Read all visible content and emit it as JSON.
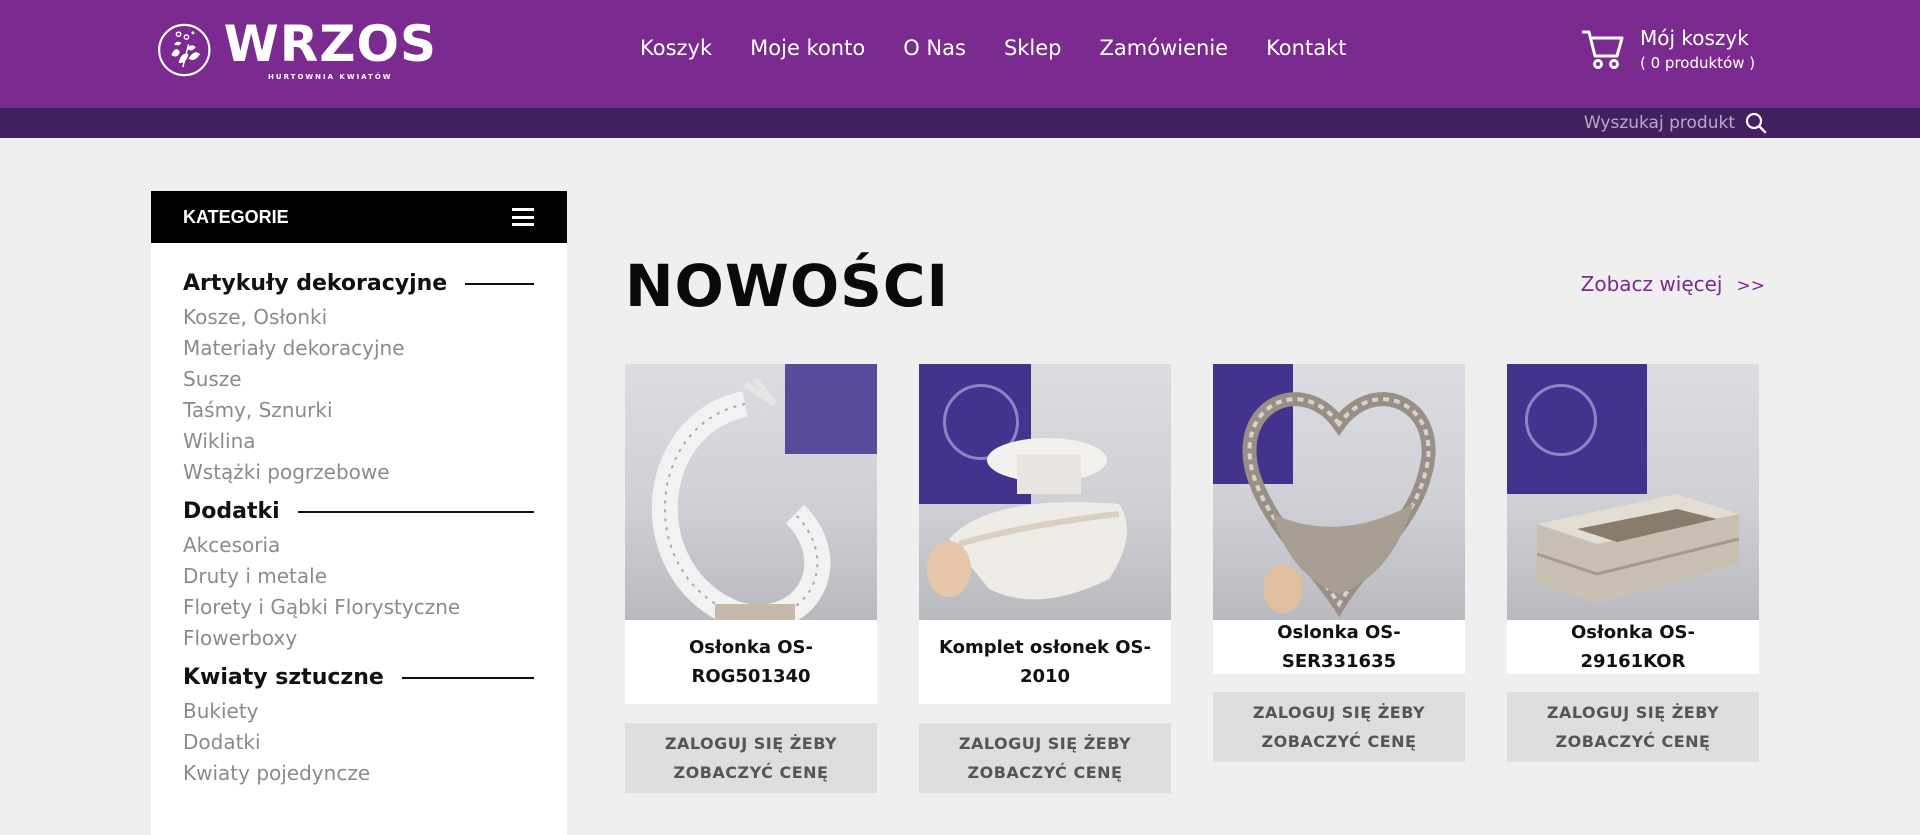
{
  "header": {
    "logo": {
      "word": "WRZOS",
      "subtitle": "HURTOWNIA KWIATÓW"
    },
    "nav": [
      "Koszyk",
      "Moje konto",
      "O Nas",
      "Sklep",
      "Zamówienie",
      "Kontakt"
    ],
    "cart": {
      "title": "Mój koszyk",
      "count": "( 0 produktów )"
    },
    "search": {
      "placeholder": "Wyszukaj produkt"
    },
    "colors": {
      "primary": "#7b2a90",
      "dark": "#42205f"
    }
  },
  "sidebar": {
    "title": "KATEGORIE",
    "groups": [
      {
        "title": "Artykuły dekoracyjne",
        "items": [
          "Kosze, Osłonki",
          "Materiały dekoracyjne",
          "Susze",
          "Taśmy, Sznurki",
          "Wiklina",
          "Wstążki pogrzebowe"
        ]
      },
      {
        "title": "Dodatki",
        "items": [
          "Akcesoria",
          "Druty i metale",
          "Florety i Gąbki Florystyczne",
          "Flowerboxy"
        ]
      },
      {
        "title": "Kwiaty sztuczne",
        "items": [
          "Bukiety",
          "Dodatki",
          "Kwiaty pojedyncze"
        ]
      }
    ]
  },
  "main": {
    "heading": "NOWOŚCI",
    "see_more": "Zobacz więcej",
    "see_more_chev": ">>",
    "products": [
      {
        "name": "Osłonka OS-ROG501340",
        "button": "ZALOGUJ SIĘ ŻEBY ZOBACZYĆ CENĘ",
        "image": "photo-woven-crescent"
      },
      {
        "name": "Komplet osłonek OS-2010",
        "button": "ZALOGUJ SIĘ ŻEBY ZOBACZYĆ CENĘ",
        "image": "photo-woven-baskets"
      },
      {
        "name": "Oslonka OS-SER331635",
        "button": "ZALOGUJ SIĘ ŻEBY ZOBACZYĆ CENĘ",
        "image": "photo-heart-basket"
      },
      {
        "name": "Osłonka OS-29161KOR",
        "button": "ZALOGUJ SIĘ ŻEBY ZOBACZYĆ CENĘ",
        "image": "photo-wooden-box"
      }
    ]
  }
}
